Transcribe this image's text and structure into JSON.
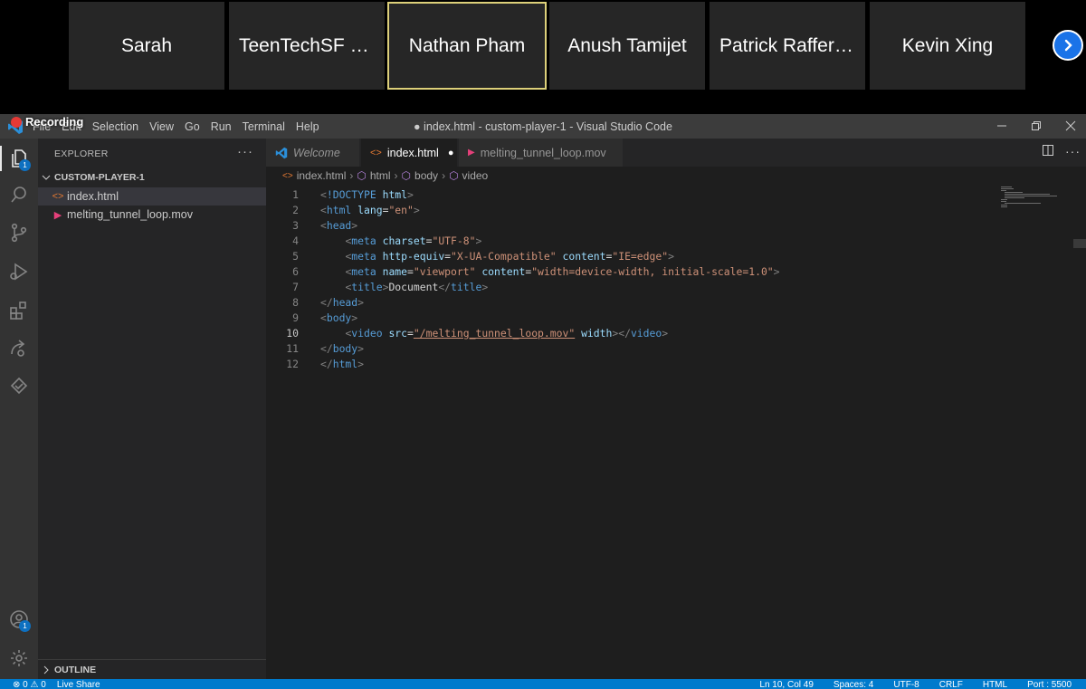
{
  "participants": [
    {
      "name": "Sarah",
      "active": false
    },
    {
      "name": "TeenTechSF L...",
      "active": false
    },
    {
      "name": "Nathan Pham",
      "active": true
    },
    {
      "name": "Anush Tamijet",
      "active": false
    },
    {
      "name": "Patrick Raffert...",
      "active": false
    },
    {
      "name": "Kevin Xing",
      "active": false
    }
  ],
  "recording_label": "Recording",
  "titlebar": {
    "menu": [
      "File",
      "Edit",
      "Selection",
      "View",
      "Go",
      "Run",
      "Terminal",
      "Help"
    ],
    "title": "● index.html - custom-player-1 - Visual Studio Code"
  },
  "activity_badges": {
    "explorer": "1",
    "accounts": "1"
  },
  "sidebar": {
    "title": "EXPLORER",
    "more": "···",
    "folder": "CUSTOM-PLAYER-1",
    "files": [
      {
        "name": "index.html",
        "icon": "<>",
        "icon_color": "#e37933"
      },
      {
        "name": "melting_tunnel_loop.mov",
        "icon": "▶",
        "icon_color": "#e5407a"
      }
    ],
    "outline": "OUTLINE"
  },
  "tabs": [
    {
      "label": "Welcome",
      "icon": "vscode-icon"
    },
    {
      "label": "index.html",
      "icon": "html-icon",
      "dirty": "●"
    },
    {
      "label": "melting_tunnel_loop.mov",
      "icon": "media-icon"
    }
  ],
  "breadcrumb": [
    "index.html",
    "html",
    "body",
    "video"
  ],
  "code_lines": [
    {
      "n": "1",
      "t": "<!DOCTYPE html>"
    },
    {
      "n": "2",
      "t": "<html lang=\"en\">"
    },
    {
      "n": "3",
      "t": "<head>"
    },
    {
      "n": "4",
      "t": "    <meta charset=\"UTF-8\">"
    },
    {
      "n": "5",
      "t": "    <meta http-equiv=\"X-UA-Compatible\" content=\"IE=edge\">"
    },
    {
      "n": "6",
      "t": "    <meta name=\"viewport\" content=\"width=device-width, initial-scale=1.0\">"
    },
    {
      "n": "7",
      "t": "    <title>Document</title>"
    },
    {
      "n": "8",
      "t": "</head>"
    },
    {
      "n": "9",
      "t": "<body>"
    },
    {
      "n": "10",
      "t": "    <video src=\"/melting_tunnel_loop.mov\" width></video>"
    },
    {
      "n": "11",
      "t": "</body>"
    },
    {
      "n": "12",
      "t": "</html>"
    }
  ],
  "current_line": "10",
  "statusbar": {
    "left": [
      "⊗ 0 ⚠ 0",
      "Live Share"
    ],
    "right": [
      "Ln 10, Col 49",
      "Spaces: 4",
      "UTF-8",
      "CRLF",
      "HTML",
      "Port : 5500"
    ]
  },
  "colors": {
    "accent": "#007acc",
    "active_tile_border": "#ddd07a",
    "record": "#e53935"
  }
}
